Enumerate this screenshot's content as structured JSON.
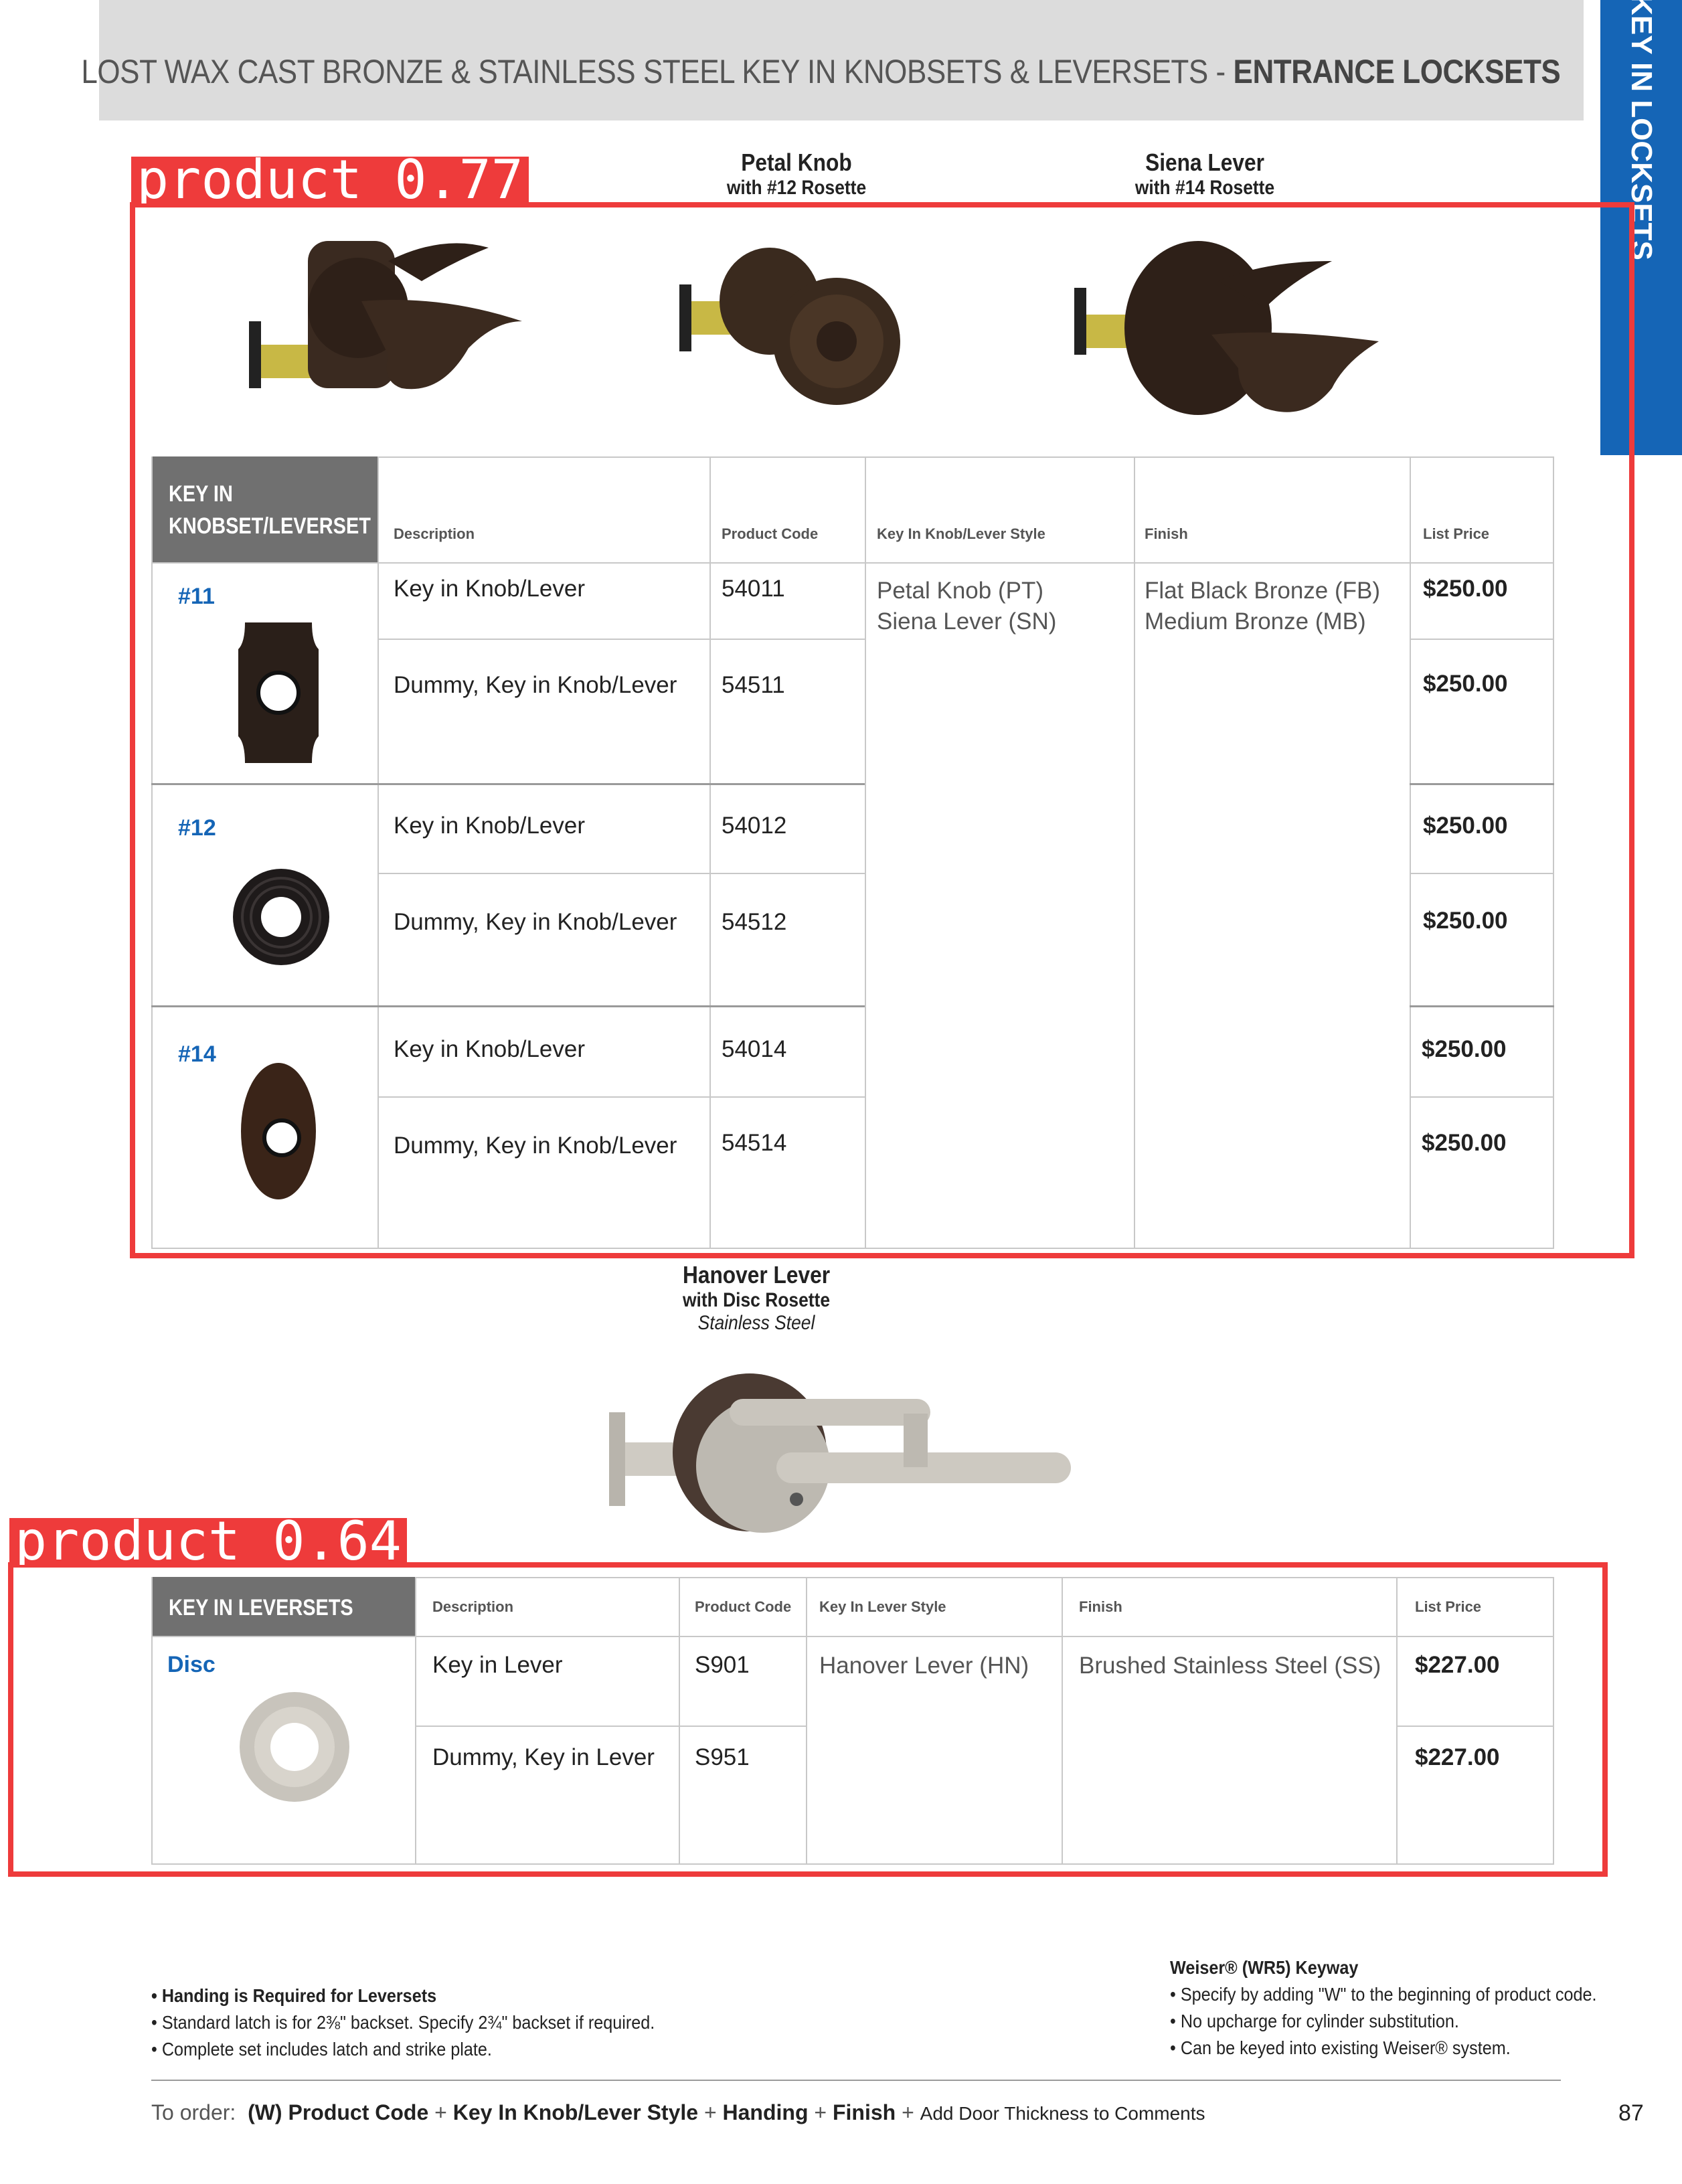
{
  "header": {
    "title_plain": "LOST WAX CAST BRONZE & STAINLESS STEEL KEY IN KNOBSETS & LEVERSETS - ",
    "title_bold": "ENTRANCE LOCKSETS"
  },
  "side_tab": {
    "label": "KEY IN LOCKSETS",
    "color": "#1565b6"
  },
  "products_top": [
    {
      "name": "Petal Knob",
      "rosette": "with #12 Rosette"
    },
    {
      "name": "Siena Lever",
      "rosette": "with #14 Rosette"
    }
  ],
  "product_mid": {
    "name": "Hanover Lever",
    "rosette": "with Disc Rosette",
    "finish": "Stainless Steel"
  },
  "detections": [
    {
      "label": "product 0.77"
    },
    {
      "label": "product 0.64"
    }
  ],
  "table1": {
    "title_line1": "KEY IN",
    "title_line2": "KNOBSET/LEVERSET",
    "columns": [
      "Description",
      "Product Code",
      "Key In Knob/Lever Style",
      "Finish",
      "List Price"
    ],
    "style_values": [
      "Petal Knob (PT)",
      "Siena Lever (SN)"
    ],
    "finish_values": [
      "Flat Black Bronze (FB)",
      "Medium Bronze (MB)"
    ],
    "groups": [
      {
        "rosette": "#11",
        "rows": [
          {
            "description": "Key in Knob/Lever",
            "code": "54011",
            "price": "$250.00"
          },
          {
            "description": "Dummy, Key in Knob/Lever",
            "code": "54511",
            "price": "$250.00"
          }
        ]
      },
      {
        "rosette": "#12",
        "rows": [
          {
            "description": "Key in Knob/Lever",
            "code": "54012",
            "price": "$250.00"
          },
          {
            "description": "Dummy, Key in Knob/Lever",
            "code": "54512",
            "price": "$250.00"
          }
        ]
      },
      {
        "rosette": "#14",
        "rows": [
          {
            "description": "Key in Knob/Lever",
            "code": "54014",
            "price": "$250.00"
          },
          {
            "description": "Dummy, Key in Knob/Lever",
            "code": "54514",
            "price": "$250.00"
          }
        ]
      }
    ]
  },
  "table2": {
    "title": "KEY IN LEVERSETS",
    "columns": [
      "Description",
      "Product Code",
      "Key In Lever Style",
      "Finish",
      "List Price"
    ],
    "style_value": "Hanover Lever (HN)",
    "finish_value": "Brushed Stainless Steel (SS)",
    "rosette": "Disc",
    "rows": [
      {
        "description": "Key in Lever",
        "code": "S901",
        "price": "$227.00"
      },
      {
        "description": "Dummy, Key in Lever",
        "code": "S951",
        "price": "$227.00"
      }
    ]
  },
  "notes_left": {
    "bold": "• Handing is Required for Leversets",
    "lines": [
      "• Standard latch is for 2⅜\" backset. Specify 2¾\" backset if required.",
      "• Complete set includes latch and strike plate."
    ]
  },
  "notes_right": {
    "title": "Weiser® (WR5) Keyway",
    "lines": [
      "• Specify by adding \"W\" to the beginning of product code.",
      "• No upcharge for cylinder substitution.",
      "• Can be keyed into existing Weiser® system."
    ]
  },
  "order_line": {
    "prefix": "To order:",
    "parts": [
      "(W) Product Code",
      "+",
      "Key In Knob/Lever Style",
      "+",
      "Handing",
      "+",
      "Finish",
      "+"
    ],
    "suffix": "Add Door Thickness to Comments"
  },
  "page_number": "87",
  "colors": {
    "accent_blue": "#1565b6",
    "detection_red": "#ee3b3b",
    "table_header_gray": "#707070"
  }
}
